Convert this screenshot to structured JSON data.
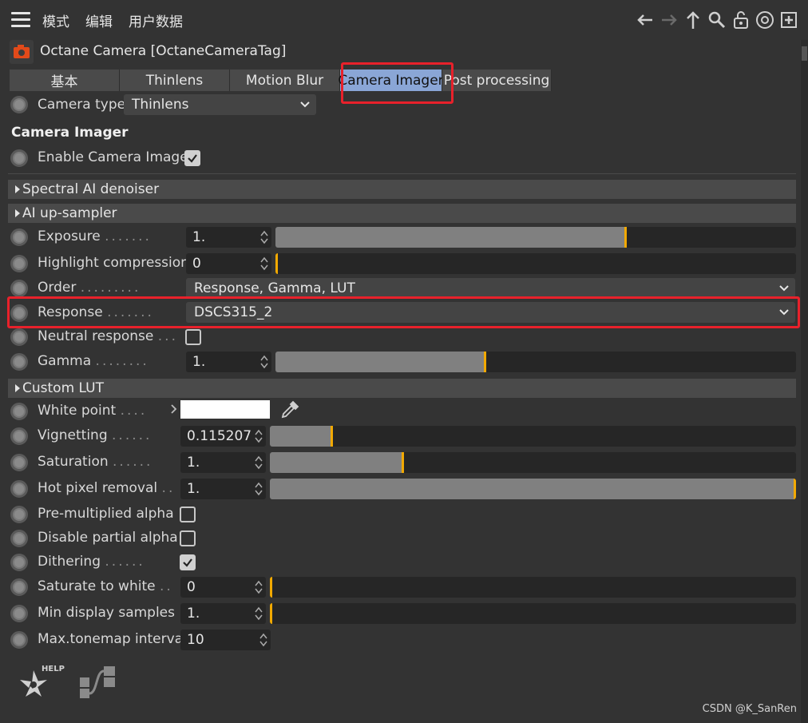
{
  "menu": {
    "items": [
      "模式",
      "编辑",
      "用户数据"
    ]
  },
  "toolbar_icons": [
    "back-arrow-icon",
    "forward-arrow-icon",
    "up-arrow-icon",
    "search-icon",
    "lock-icon",
    "target-icon",
    "new-window-icon"
  ],
  "object": {
    "title": "Octane Camera [OctaneCameraTag]"
  },
  "tabs": [
    "基本",
    "Thinlens",
    "Motion Blur",
    "Camera Imager",
    "Post processing"
  ],
  "active_tab": "Camera Imager",
  "camera_type": {
    "label": "Camera type",
    "value": "Thinlens"
  },
  "section_title": "Camera Imager",
  "enable_imager": {
    "label": "Enable Camera Imager",
    "checked": true
  },
  "groups": {
    "denoiser": "Spectral AI denoiser",
    "upsampler": "AI up-sampler",
    "custom_lut": "Custom LUT"
  },
  "params": {
    "exposure": {
      "label": "Exposure",
      "value": "1.",
      "level": 0.67
    },
    "highlight": {
      "label": "Highlight compression",
      "value": "0",
      "level": 0.0
    },
    "order": {
      "label": "Order",
      "value": "Response, Gamma, LUT"
    },
    "response": {
      "label": "Response",
      "value": "DSCS315_2"
    },
    "neutral": {
      "label": "Neutral response",
      "checked": false
    },
    "gamma": {
      "label": "Gamma",
      "value": "1.",
      "level": 0.4
    },
    "white_point": {
      "label": "White point",
      "color": "#ffffff"
    },
    "vignetting": {
      "label": "Vignetting",
      "value": "0.115207",
      "level": 0.115
    },
    "saturation": {
      "label": "Saturation",
      "value": "1.",
      "level": 0.25
    },
    "hot_pixel": {
      "label": "Hot pixel removal",
      "value": "1.",
      "level": 1.0
    },
    "premult": {
      "label": "Pre-multiplied alpha",
      "checked": false
    },
    "partial_alpha": {
      "label": "Disable partial alpha",
      "checked": false
    },
    "dithering": {
      "label": "Dithering",
      "checked": true
    },
    "sat_white": {
      "label": "Saturate to white",
      "value": "0",
      "level": 0.0
    },
    "min_samples": {
      "label": "Min display samples",
      "value": "1.",
      "level": 0.0
    },
    "tonemap": {
      "label": "Max.tonemap interval",
      "value": "10"
    }
  },
  "bottom": {
    "help_label": "HELP"
  },
  "watermark": "CSDN @K_SanRen",
  "colors": {
    "highlight_box": "#e8212b",
    "active_tab": "#8aa6d6",
    "slider_knob": "#f2a900",
    "slider_fill": "#808080"
  }
}
